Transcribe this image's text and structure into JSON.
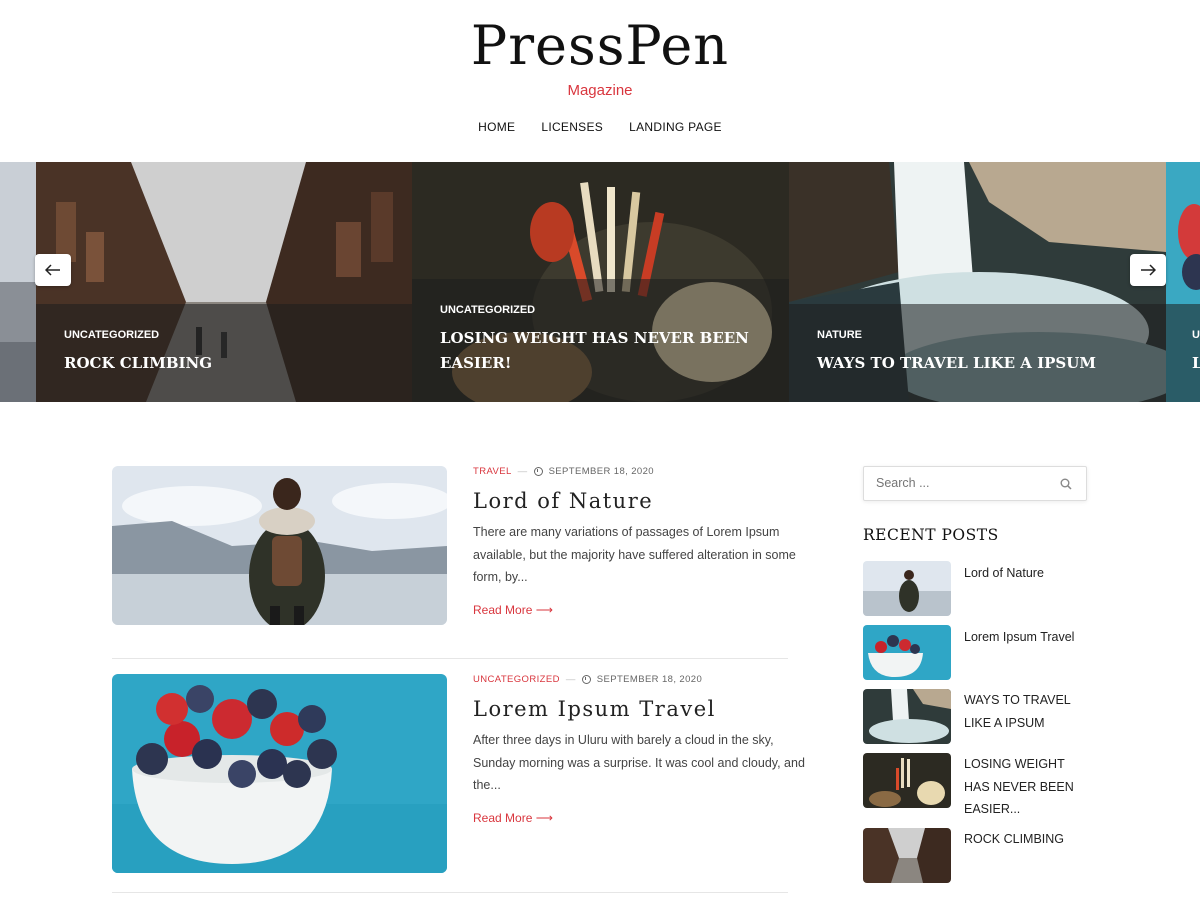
{
  "site": {
    "title": "PressPen",
    "tagline": "Magazine"
  },
  "nav": {
    "items": [
      {
        "label": "HOME"
      },
      {
        "label": "LICENSES"
      },
      {
        "label": "LANDING PAGE"
      }
    ]
  },
  "slider": {
    "prev_icon": "arrow-left-icon",
    "next_icon": "arrow-right-icon",
    "slides": [
      {
        "category": "UNCATEGORIZED",
        "title": "ROCK CLIMBING"
      },
      {
        "category": "UNCATEGORIZED",
        "title": "LOSING WEIGHT HAS NEVER BEEN EASIER!"
      },
      {
        "category": "NATURE",
        "title": "WAYS TO TRAVEL LIKE A IPSUM"
      },
      {
        "category": "U",
        "title": "L"
      }
    ]
  },
  "posts": [
    {
      "category": "TRAVEL",
      "date": "SEPTEMBER 18, 2020",
      "title": "Lord of Nature",
      "excerpt": "There are many variations of passages of Lorem Ipsum available, but the majority have suffered alteration in some form, by...",
      "read_more": "Read More ⟶"
    },
    {
      "category": "UNCATEGORIZED",
      "date": "SEPTEMBER 18, 2020",
      "title": "Lorem Ipsum Travel",
      "excerpt": "After three days in Uluru with barely a cloud in the sky, Sunday morning was a surprise. It was cool and cloudy, and the...",
      "read_more": "Read More ⟶"
    }
  ],
  "sidebar": {
    "search": {
      "placeholder": "Search ...",
      "icon": "search-icon"
    },
    "recent_heading": "RECENT POSTS",
    "recent_posts": [
      {
        "title": "Lord of Nature"
      },
      {
        "title": "Lorem Ipsum Travel"
      },
      {
        "title": "WAYS TO TRAVEL LIKE A IPSUM"
      },
      {
        "title": "LOSING WEIGHT HAS NEVER BEEN EASIER..."
      },
      {
        "title": "ROCK CLIMBING"
      }
    ]
  },
  "colors": {
    "accent": "#d9363e",
    "text": "#222222",
    "overlay": "rgba(30,30,30,0.55)"
  }
}
